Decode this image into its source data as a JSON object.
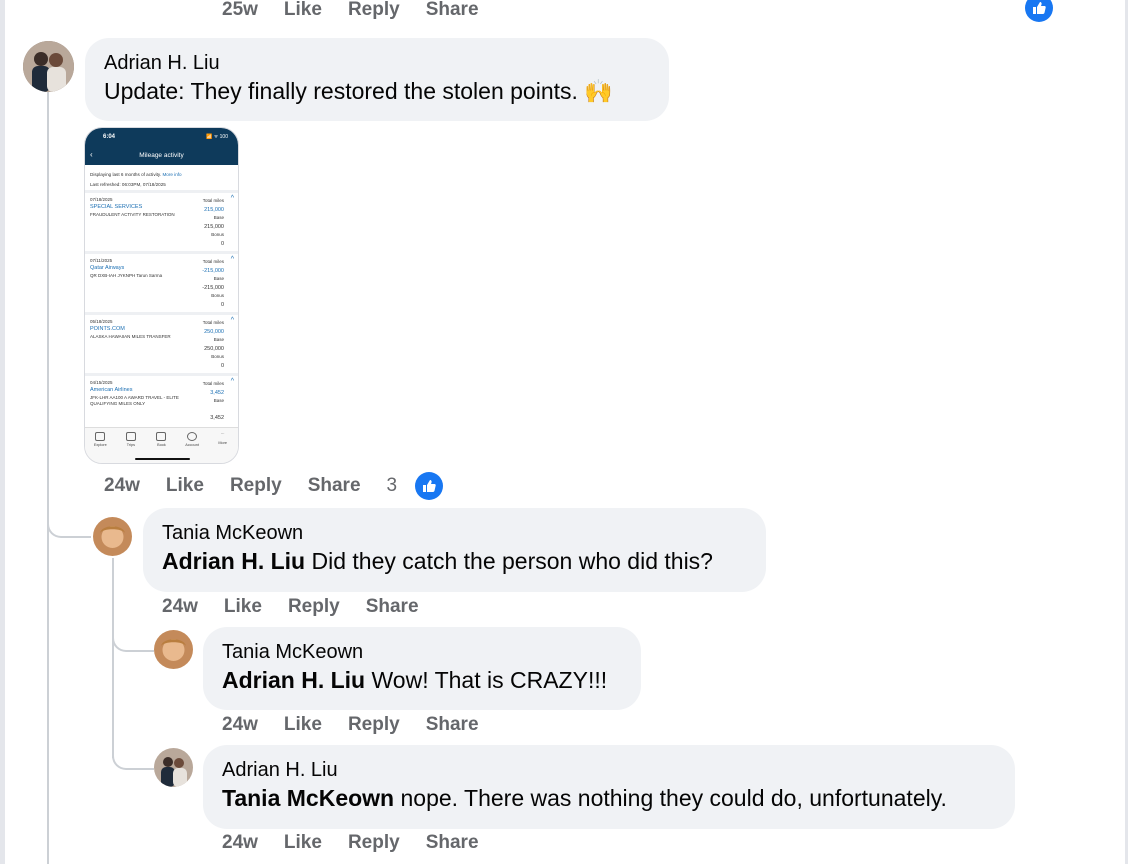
{
  "top_actions": {
    "time": "25w",
    "like": "Like",
    "reply": "Reply",
    "share": "Share"
  },
  "comment1": {
    "author": "Adrian H. Liu",
    "text": "Update: They finally restored the stolen points. 🙌",
    "actions": {
      "time": "24w",
      "like": "Like",
      "reply": "Reply",
      "share": "Share",
      "reaction_count": "3"
    },
    "image": {
      "status_time": "6:04",
      "status_right": "📶 ᯤ 100",
      "title": "Mileage activity",
      "info_line": "Displaying last 6 months of activity.",
      "info_link": "More info",
      "refreshed": "Last refreshed: 06:03PM, 07/18/2025",
      "entries": [
        {
          "date": "07/18/2025",
          "name": "SPECIAL SERVICES",
          "desc": "FRAUDULENT ACTIVITY RESTORATION",
          "total_label": "Total miles",
          "total": "215,000",
          "base_label": "Base",
          "base": "215,000",
          "bonus_label": "Bonus",
          "bonus": "0"
        },
        {
          "date": "07/11/2025",
          "name": "Qatar Airways",
          "desc": "QR DXB-IAH JYKNPH Tarun Sarma",
          "total_label": "Total miles",
          "total": "-215,000",
          "base_label": "Base",
          "base": "-215,000",
          "bonus_label": "Bonus",
          "bonus": "0"
        },
        {
          "date": "05/18/2025",
          "name": "POINTS.COM",
          "desc": "ALASKA HAWAIIAN MILES TRANSFER",
          "total_label": "Total miles",
          "total": "250,000",
          "base_label": "Base",
          "base": "250,000",
          "bonus_label": "Bonus",
          "bonus": "0"
        },
        {
          "date": "04/15/2025",
          "name": "American Airlines",
          "desc": "JFK-LHR AA100 A AWARD TRAVEL - ELITE QUALIFYING MILES ONLY",
          "total_label": "Total miles",
          "total": "3,452",
          "base_label": "Base",
          "base": "3,452",
          "bonus_label": "",
          "bonus": ""
        }
      ],
      "nav": [
        "Explore",
        "Trips",
        "Book",
        "Account",
        "More"
      ]
    }
  },
  "reply1": {
    "author": "Tania McKeown",
    "mention": "Adrian H. Liu",
    "text": " Did they catch the person who did this?",
    "actions": {
      "time": "24w",
      "like": "Like",
      "reply": "Reply",
      "share": "Share"
    }
  },
  "reply2": {
    "author": "Tania McKeown",
    "mention": "Adrian H. Liu",
    "text": " Wow! That is CRAZY!!!",
    "actions": {
      "time": "24w",
      "like": "Like",
      "reply": "Reply",
      "share": "Share"
    }
  },
  "reply3": {
    "author": "Adrian H. Liu",
    "mention": "Tania McKeown",
    "text": " nope. There was nothing they could do, unfortunately.",
    "actions": {
      "time": "24w",
      "like": "Like",
      "reply": "Reply",
      "share": "Share"
    }
  },
  "colors": {
    "like_blue": "#1877f2",
    "bubble_bg": "#f0f2f5",
    "meta_gray": "#65676b"
  }
}
